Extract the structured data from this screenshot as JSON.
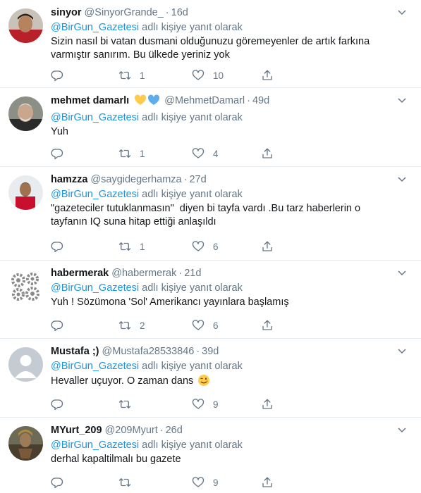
{
  "tweets": [
    {
      "name": "sinyor",
      "handle": "@SinyorGrande_",
      "time": "16d",
      "reply_prefix": "@BirGun_Gazetesi",
      "reply_suffix": " adlı kişiye yanıt olarak",
      "text": "Sizin nasıl bi vatan dusmani olduğunuzu göremeyenler de artık farkına varmıştır sanırım. Bu ülkede yeriniz yok",
      "replies": "",
      "retweets": "1",
      "likes": "10"
    },
    {
      "name": "mehmet damarlı",
      "handle": "@MehmetDamarl",
      "time": "49d",
      "reply_prefix": "@BirGun_Gazetesi",
      "reply_suffix": " adlı kişiye yanıt olarak",
      "text": "Yuh",
      "replies": "",
      "retweets": "1",
      "likes": "4"
    },
    {
      "name": "hamzza",
      "handle": "@saygidegerhamza",
      "time": "27d",
      "reply_prefix": "@BirGun_Gazetesi",
      "reply_suffix": " adlı kişiye yanıt olarak",
      "text": "\"gazeteciler tutuklanmasın\"  diyen bi tayfa vardı .Bu tarz haberlerin o tayfanın IQ suna hitap ettiği anlaşıldı",
      "replies": "",
      "retweets": "1",
      "likes": "6"
    },
    {
      "name": "habermerak",
      "handle": "@habermerak",
      "time": "21d",
      "reply_prefix": "@BirGun_Gazetesi",
      "reply_suffix": " adlı kişiye yanıt olarak",
      "text": "Yuh ! Sözümona 'Sol' Amerikancı yayınlara başlamış",
      "replies": "",
      "retweets": "2",
      "likes": "6"
    },
    {
      "name": "Mustafa ;)",
      "handle": "@Mustafa28533846",
      "time": "39d",
      "reply_prefix": "@BirGun_Gazetesi",
      "reply_suffix": " adlı kişiye yanıt olarak",
      "text": "Hevaller uçuyor. O zaman dans",
      "replies": "",
      "retweets": "",
      "likes": "9"
    },
    {
      "name": "MYurt_209",
      "handle": "@209Myurt",
      "time": "26d",
      "reply_prefix": "@BirGun_Gazetesi",
      "reply_suffix": " adlı kişiye yanıt olarak",
      "text": "derhal kapaltilmalı bu gazete",
      "replies": "",
      "retweets": "",
      "likes": "9"
    }
  ],
  "icons": {
    "reply": "reply-icon",
    "retweet": "retweet-icon",
    "like": "heart-icon",
    "share": "share-icon",
    "more": "chevron-down-icon"
  },
  "colors": {
    "text": "#14171a",
    "secondary": "#657786",
    "link": "#1b95e0",
    "divider": "#e6ecf0"
  }
}
